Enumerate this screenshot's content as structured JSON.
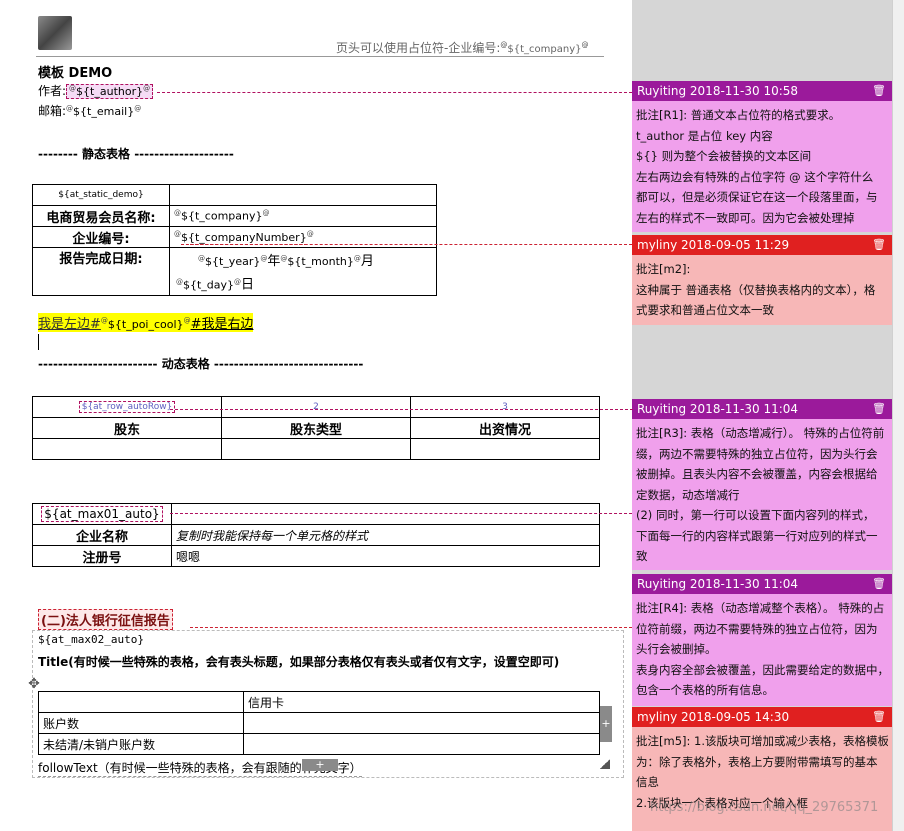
{
  "header": {
    "placeholder_text": "页头可以使用占位符-企业编号:",
    "placeholder_key": "${t_company}",
    "marker": "@"
  },
  "doc": {
    "title": "模板 DEMO",
    "author_label": "作者:",
    "author_key": "${t_author}",
    "email_label": "邮箱:",
    "email_key": "${t_email}",
    "static_heading": "-------- 静态表格 --------------------",
    "static_table": {
      "demo_key": "${at_static_demo}",
      "rows": [
        {
          "label": "电商贸易会员名称:",
          "value": "${t_company}"
        },
        {
          "label": "企业编号:",
          "value": "${t_companyNumber}"
        },
        {
          "label": "报告完成日期:",
          "value_parts": [
            "${t_year}",
            "年",
            "${t_month}",
            "月",
            "${t_day}",
            "日"
          ]
        }
      ]
    },
    "highlight_line": {
      "left": "我是左边#",
      "key": "${t_poi_cool}",
      "right": "#我是右边"
    },
    "dynamic_heading": "------------------------ 动态表格 ------------------------------",
    "dynamic_table": {
      "row_key": "${at_row_autoRow}",
      "col2": "2",
      "col3": "3",
      "headers": [
        "股东",
        "股东类型",
        "出资情况"
      ]
    },
    "max01_table": {
      "key": "${at_max01_auto}",
      "rows": [
        {
          "label": "企业名称",
          "value": "复制时我能保持每一个单元格的样式"
        },
        {
          "label": "注册号",
          "value": "嗯嗯"
        }
      ]
    },
    "section_title": "(二)法人银行征信报告",
    "max02_key": "${at_max02_auto}",
    "title_line": "Title(有时候一些特殊的表格，会有表头标题，如果部分表格仅有表头或者仅有文字，设置空即可)",
    "max02_table": {
      "header": "信用卡",
      "rows": [
        "账户数",
        "未结清/未销户账户数"
      ]
    },
    "follow_text": "followText（有时候一些特殊的表格，会有跟随的补充文字）"
  },
  "comments": [
    {
      "author": "Ruyiting 2018-11-30 10:58",
      "color": "#9b1a9b",
      "body_color": "#f0a0ec",
      "lines": [
        "批注[R1]: 普通文本占位符的格式要求。",
        "t_author  是占位 key 内容",
        "${} 则为整个会被替换的文本区间",
        "左右两边会有特殊的占位字符 @ 这个字符什么",
        "都可以，但是必须保证它在这一个段落里面，与",
        "左右的样式不一致即可。因为它会被处理掉"
      ]
    },
    {
      "author": "myliny 2018-09-05 11:29",
      "color": "#e02020",
      "body_color": "#f7b7b7",
      "lines": [
        "批注[m2]:",
        "这种属于 普通表格（仅替换表格内的文本），格",
        "式要求和普通占位文本一致"
      ]
    },
    {
      "author": "Ruyiting 2018-11-30 11:04",
      "color": "#9b1a9b",
      "body_color": "#f0a0ec",
      "lines": [
        "批注[R3]: 表格（动态增减行）。 特殊的占位符前",
        "缀，两边不需要特殊的独立占位符，因为头行会",
        "被删掉。且表头内容不会被覆盖，内容会根据给",
        "定数据，动态增减行",
        "(2) 同时，第一行可以设置下面内容列的样式，",
        "下面每一行的内容样式跟第一行对应列的样式一",
        "致"
      ]
    },
    {
      "author": "Ruyiting 2018-11-30 11:04",
      "color": "#9b1a9b",
      "body_color": "#f0a0ec",
      "lines": [
        "批注[R4]: 表格（动态增减整个表格）。 特殊的占",
        "位符前缀，两边不需要特殊的独立占位符，因为",
        "头行会被删掉。",
        "表身内容全部会被覆盖，因此需要给定的数据中，",
        "包含一个表格的所有信息。"
      ]
    },
    {
      "author": "myliny 2018-09-05 14:30",
      "color": "#e02020",
      "body_color": "#f7b7b7",
      "lines": [
        "批注[m5]: 1.该版块可增加或减少表格，表格模板",
        "为：除了表格外，表格上方要附带需填写的基本",
        "信息",
        "2.该版块一个表格对应一个输入框"
      ]
    }
  ],
  "watermark": "https://blog.csdn.net/qq_29765371",
  "icons": {
    "trash": "trash-icon",
    "logo": "avatar-logo",
    "move": "move-handle-icon",
    "add": "add-row-icon",
    "resize": "resize-icon"
  }
}
